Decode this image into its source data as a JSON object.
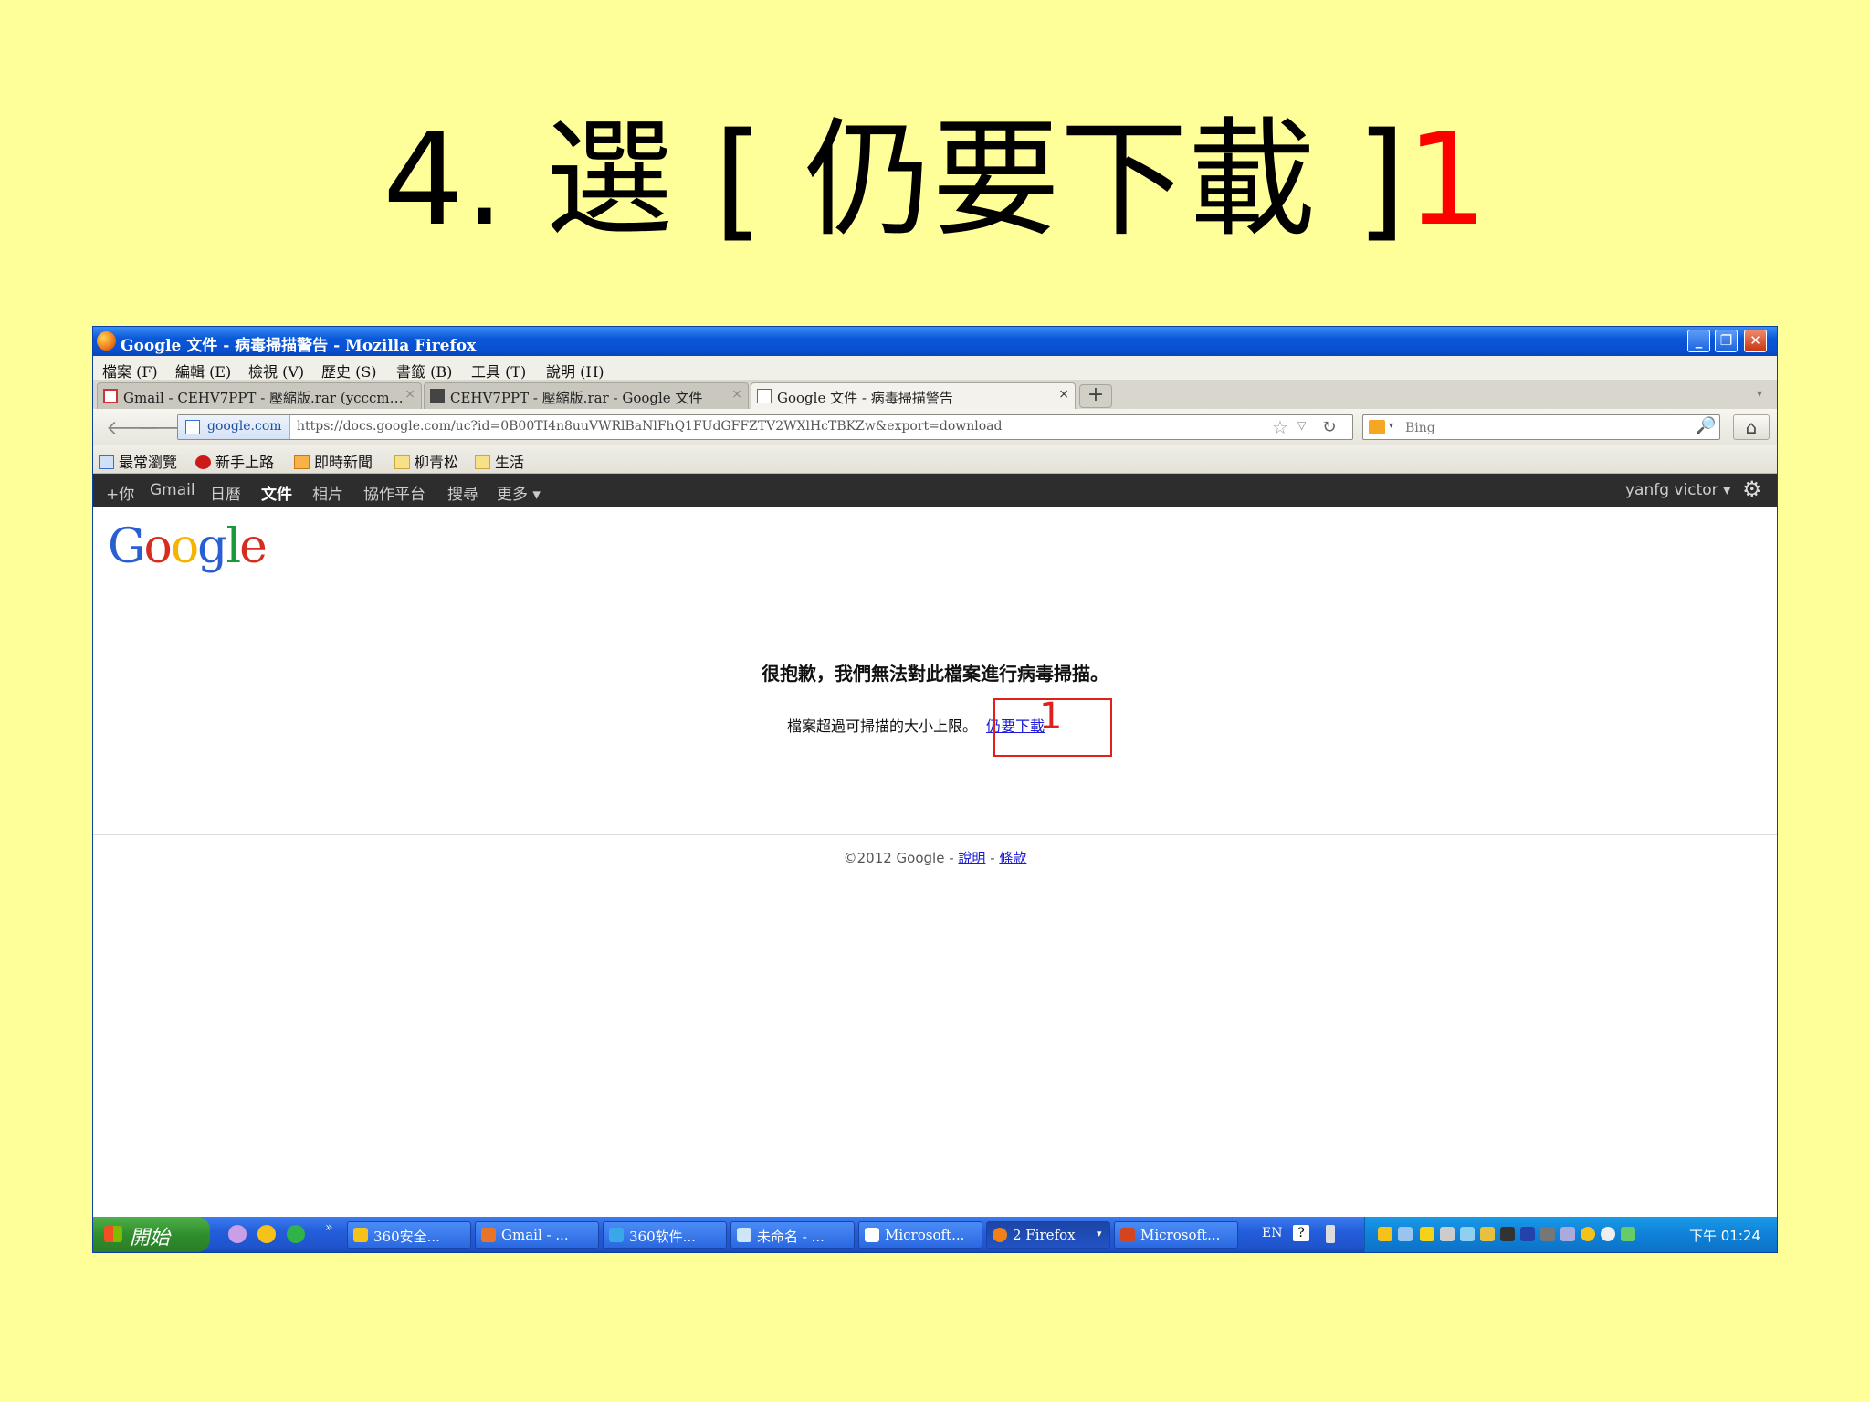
{
  "slide": {
    "title_main": "4. 選 [ 仍要下載 ]",
    "title_num": "1"
  },
  "window": {
    "title": "Google 文件 - 病毒掃描警告 - Mozilla Firefox",
    "controls": {
      "minimize": "_",
      "restore": "❐",
      "close": "✕"
    }
  },
  "menu": {
    "items": [
      "檔案 (F)",
      "編輯 (E)",
      "檢視 (V)",
      "歷史 (S)",
      "書籤 (B)",
      "工具 (T)",
      "說明 (H)"
    ]
  },
  "tabs": [
    {
      "label": "Gmail - CEHV7PPT - 壓縮版.rar (ycccm…",
      "icon": "gmail-icon"
    },
    {
      "label": "CEHV7PPT - 壓縮版.rar - Google 文件",
      "icon": "document-icon"
    },
    {
      "label": "Google 文件 - 病毒掃描警告",
      "icon": "google-docs-icon",
      "active": true
    }
  ],
  "navbar": {
    "site_identity": "google.com",
    "url": "https://docs.google.com/uc?id=0B00TI4n8uuVWRlBaNlFhQ1FUdGFFZTV2WXlHcTBKZw&export=download",
    "search_placeholder": "Bing"
  },
  "bookmarks": {
    "items": [
      "最常瀏覽",
      "新手上路",
      "即時新聞",
      "柳青松",
      "生活"
    ]
  },
  "google_bar": {
    "items": [
      "+你",
      "Gmail",
      "日曆",
      "文件",
      "相片",
      "協作平台",
      "搜尋",
      "更多 ▾"
    ],
    "active": "文件",
    "user": "yanfg victor ▾"
  },
  "page": {
    "logo": [
      "G",
      "o",
      "o",
      "g",
      "l",
      "e"
    ],
    "warning_heading": "很抱歉，我們無法對此檔案進行病毒掃描。",
    "warning_text": "檔案超過可掃描的大小上限。",
    "download_link": "仍要下載",
    "annotation_number": "1",
    "footer_copy": "©2012 Google - ",
    "footer_help": "說明",
    "footer_sep": " - ",
    "footer_terms": "條款"
  },
  "taskbar": {
    "start_label": "開始",
    "chevron": "»",
    "items": [
      "360安全...",
      "Gmail - ...",
      "360软件...",
      "未命名 - ...",
      "Microsoft...",
      "2 Firefox",
      "Microsoft..."
    ],
    "language": "EN",
    "help": "?",
    "clock": "下午 01:24"
  },
  "colors": {
    "slide_background": "#ffff99",
    "annotation_red": "#e0201a",
    "link_blue": "#1a1ad8",
    "taskbar_blue": "#245edb"
  }
}
